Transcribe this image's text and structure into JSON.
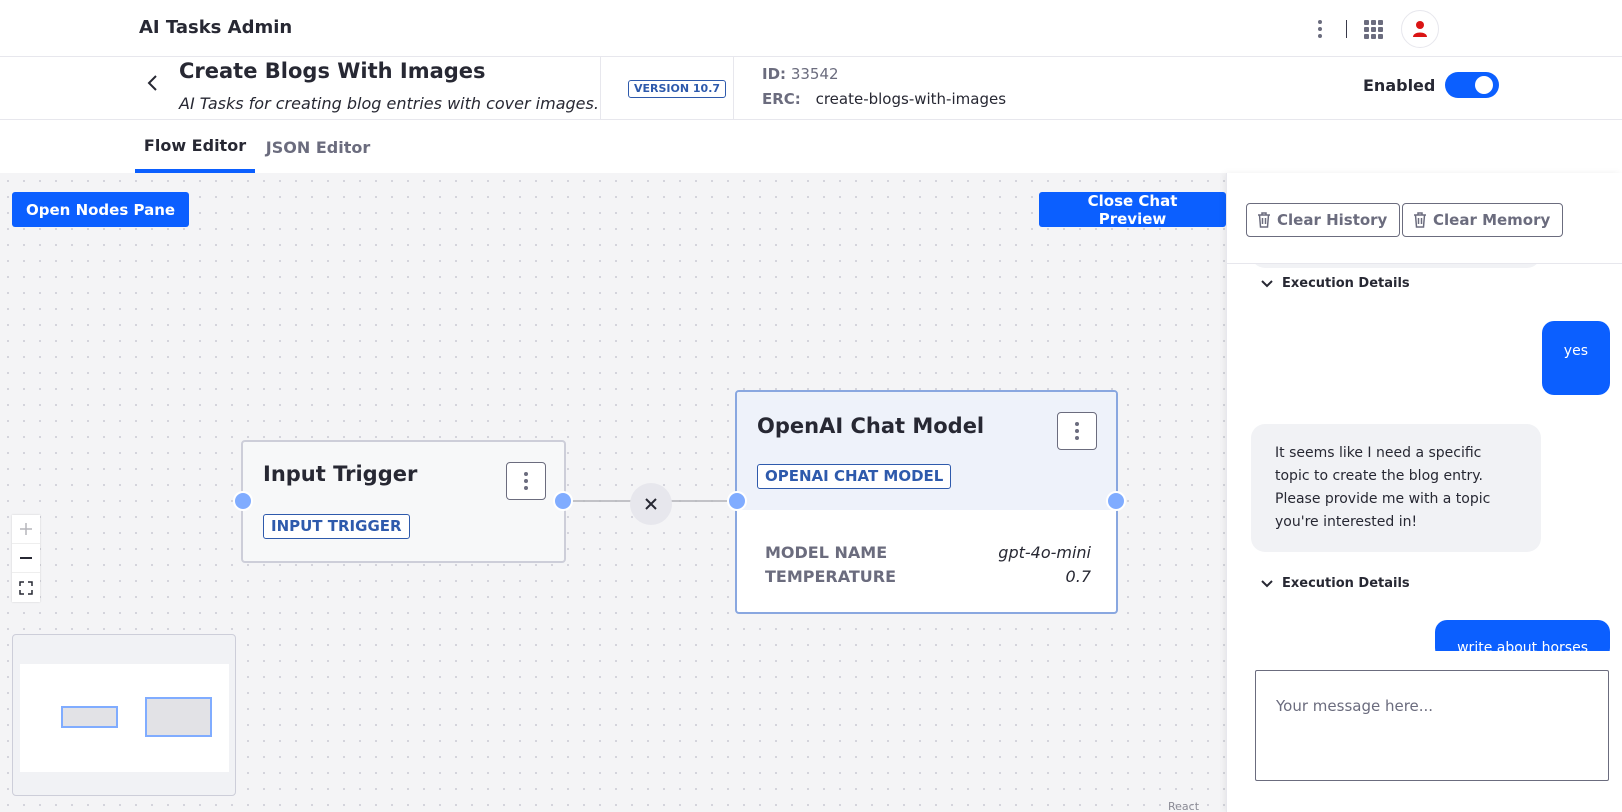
{
  "app": {
    "title": "AI Tasks Admin"
  },
  "header": {
    "title": "Create Blogs With Images",
    "subtitle": "AI Tasks for creating blog entries with cover images.",
    "version_badge": "VERSION 10.7",
    "id_label": "ID:",
    "id_value": "33542",
    "erc_label": "ERC:",
    "erc_value": "create-blogs-with-images",
    "enabled_label": "Enabled",
    "enabled": true
  },
  "tabs": [
    {
      "label": "Flow Editor",
      "active": true
    },
    {
      "label": "JSON Editor",
      "active": false
    }
  ],
  "canvas": {
    "open_nodes_label": "Open Nodes Pane",
    "close_chat_label": "Close Chat Preview",
    "attribution": "React Flow",
    "nodes": {
      "input_trigger": {
        "title": "Input Trigger",
        "tag": "INPUT TRIGGER"
      },
      "openai": {
        "title": "OpenAI Chat Model",
        "tag": "OPENAI CHAT MODEL",
        "props": [
          {
            "key": "MODEL NAME",
            "value": "gpt-4o-mini"
          },
          {
            "key": "TEMPERATURE",
            "value": "0.7"
          }
        ]
      }
    }
  },
  "chat": {
    "clear_history_label": "Clear History",
    "clear_memory_label": "Clear Memory",
    "execution_details_label": "Execution Details",
    "messages": [
      {
        "role": "user",
        "text": "yes"
      },
      {
        "role": "assistant",
        "text": "It seems like I need a specific topic to create the blog entry. Please provide me with a topic you're interested in!"
      },
      {
        "role": "user",
        "text": "write about horses"
      }
    ],
    "input_placeholder": "Your message here..."
  },
  "colors": {
    "primary": "#0b5fff",
    "tag_blue": "#2e5aac",
    "handle": "#80acff",
    "avatar_icon": "#da1414"
  }
}
